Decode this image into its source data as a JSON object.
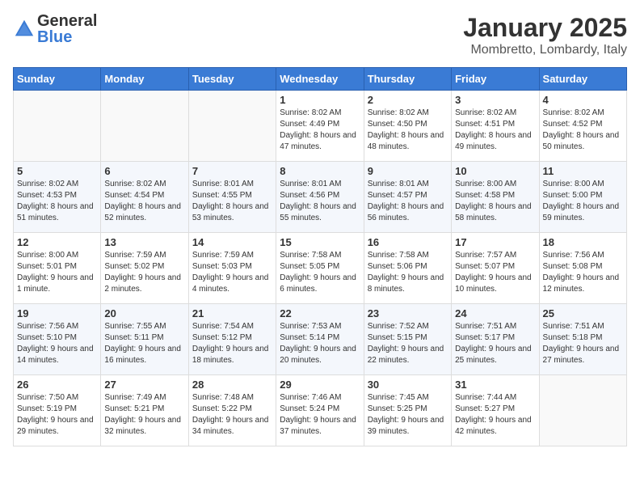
{
  "logo": {
    "general": "General",
    "blue": "Blue"
  },
  "calendar": {
    "title": "January 2025",
    "subtitle": "Mombretto, Lombardy, Italy"
  },
  "headers": [
    "Sunday",
    "Monday",
    "Tuesday",
    "Wednesday",
    "Thursday",
    "Friday",
    "Saturday"
  ],
  "weeks": [
    [
      {
        "day": "",
        "info": ""
      },
      {
        "day": "",
        "info": ""
      },
      {
        "day": "",
        "info": ""
      },
      {
        "day": "1",
        "info": "Sunrise: 8:02 AM\nSunset: 4:49 PM\nDaylight: 8 hours and 47 minutes."
      },
      {
        "day": "2",
        "info": "Sunrise: 8:02 AM\nSunset: 4:50 PM\nDaylight: 8 hours and 48 minutes."
      },
      {
        "day": "3",
        "info": "Sunrise: 8:02 AM\nSunset: 4:51 PM\nDaylight: 8 hours and 49 minutes."
      },
      {
        "day": "4",
        "info": "Sunrise: 8:02 AM\nSunset: 4:52 PM\nDaylight: 8 hours and 50 minutes."
      }
    ],
    [
      {
        "day": "5",
        "info": "Sunrise: 8:02 AM\nSunset: 4:53 PM\nDaylight: 8 hours and 51 minutes."
      },
      {
        "day": "6",
        "info": "Sunrise: 8:02 AM\nSunset: 4:54 PM\nDaylight: 8 hours and 52 minutes."
      },
      {
        "day": "7",
        "info": "Sunrise: 8:01 AM\nSunset: 4:55 PM\nDaylight: 8 hours and 53 minutes."
      },
      {
        "day": "8",
        "info": "Sunrise: 8:01 AM\nSunset: 4:56 PM\nDaylight: 8 hours and 55 minutes."
      },
      {
        "day": "9",
        "info": "Sunrise: 8:01 AM\nSunset: 4:57 PM\nDaylight: 8 hours and 56 minutes."
      },
      {
        "day": "10",
        "info": "Sunrise: 8:00 AM\nSunset: 4:58 PM\nDaylight: 8 hours and 58 minutes."
      },
      {
        "day": "11",
        "info": "Sunrise: 8:00 AM\nSunset: 5:00 PM\nDaylight: 8 hours and 59 minutes."
      }
    ],
    [
      {
        "day": "12",
        "info": "Sunrise: 8:00 AM\nSunset: 5:01 PM\nDaylight: 9 hours and 1 minute."
      },
      {
        "day": "13",
        "info": "Sunrise: 7:59 AM\nSunset: 5:02 PM\nDaylight: 9 hours and 2 minutes."
      },
      {
        "day": "14",
        "info": "Sunrise: 7:59 AM\nSunset: 5:03 PM\nDaylight: 9 hours and 4 minutes."
      },
      {
        "day": "15",
        "info": "Sunrise: 7:58 AM\nSunset: 5:05 PM\nDaylight: 9 hours and 6 minutes."
      },
      {
        "day": "16",
        "info": "Sunrise: 7:58 AM\nSunset: 5:06 PM\nDaylight: 9 hours and 8 minutes."
      },
      {
        "day": "17",
        "info": "Sunrise: 7:57 AM\nSunset: 5:07 PM\nDaylight: 9 hours and 10 minutes."
      },
      {
        "day": "18",
        "info": "Sunrise: 7:56 AM\nSunset: 5:08 PM\nDaylight: 9 hours and 12 minutes."
      }
    ],
    [
      {
        "day": "19",
        "info": "Sunrise: 7:56 AM\nSunset: 5:10 PM\nDaylight: 9 hours and 14 minutes."
      },
      {
        "day": "20",
        "info": "Sunrise: 7:55 AM\nSunset: 5:11 PM\nDaylight: 9 hours and 16 minutes."
      },
      {
        "day": "21",
        "info": "Sunrise: 7:54 AM\nSunset: 5:12 PM\nDaylight: 9 hours and 18 minutes."
      },
      {
        "day": "22",
        "info": "Sunrise: 7:53 AM\nSunset: 5:14 PM\nDaylight: 9 hours and 20 minutes."
      },
      {
        "day": "23",
        "info": "Sunrise: 7:52 AM\nSunset: 5:15 PM\nDaylight: 9 hours and 22 minutes."
      },
      {
        "day": "24",
        "info": "Sunrise: 7:51 AM\nSunset: 5:17 PM\nDaylight: 9 hours and 25 minutes."
      },
      {
        "day": "25",
        "info": "Sunrise: 7:51 AM\nSunset: 5:18 PM\nDaylight: 9 hours and 27 minutes."
      }
    ],
    [
      {
        "day": "26",
        "info": "Sunrise: 7:50 AM\nSunset: 5:19 PM\nDaylight: 9 hours and 29 minutes."
      },
      {
        "day": "27",
        "info": "Sunrise: 7:49 AM\nSunset: 5:21 PM\nDaylight: 9 hours and 32 minutes."
      },
      {
        "day": "28",
        "info": "Sunrise: 7:48 AM\nSunset: 5:22 PM\nDaylight: 9 hours and 34 minutes."
      },
      {
        "day": "29",
        "info": "Sunrise: 7:46 AM\nSunset: 5:24 PM\nDaylight: 9 hours and 37 minutes."
      },
      {
        "day": "30",
        "info": "Sunrise: 7:45 AM\nSunset: 5:25 PM\nDaylight: 9 hours and 39 minutes."
      },
      {
        "day": "31",
        "info": "Sunrise: 7:44 AM\nSunset: 5:27 PM\nDaylight: 9 hours and 42 minutes."
      },
      {
        "day": "",
        "info": ""
      }
    ]
  ]
}
